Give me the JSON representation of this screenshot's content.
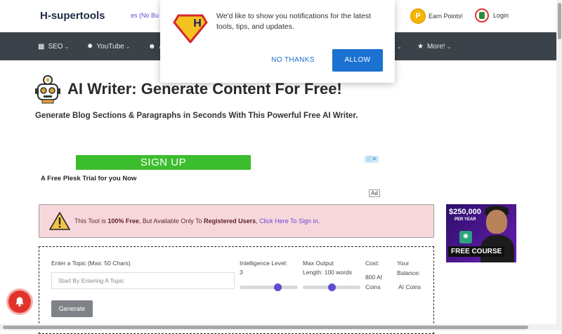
{
  "header": {
    "logo": "H-supertools",
    "ticker": "es (No Bu",
    "earn_points": "Earn Points!",
    "coin_glyph": "P",
    "login": "Login"
  },
  "nav": {
    "items": [
      {
        "label": "SEO",
        "icon": "chart-icon"
      },
      {
        "label": "YouTube",
        "icon": "gear-icon"
      },
      {
        "label": "A",
        "icon": "robot-icon"
      },
      {
        "label": "More!",
        "icon": "star-icon"
      }
    ]
  },
  "page": {
    "title": "AI Writer: Generate Content For Free!",
    "subtitle": "Generate Blog Sections & Paragraphs in Seconds With This Powerful Free AI Writer."
  },
  "ad": {
    "button": "SIGN UP",
    "text": "A Free Plesk Trial for you Now",
    "choice": "ⓘ✕",
    "label": "Ad"
  },
  "alert": {
    "prefix": "This Tool is ",
    "free": "100% Free",
    "middle": ", But Available Only To ",
    "registered": "Registered Users",
    "sep": ", ",
    "link": "Click Here To Sign in",
    "suffix": "."
  },
  "promo": {
    "amount": "$250,000",
    "per": "PER YEAR",
    "course": "FREE COURSE"
  },
  "tool": {
    "topic_label": "Enter a Topic (Max: 50 Chars)",
    "topic_placeholder": "Start By Entering A Topic",
    "intelligence_label": "Intelligence Level:",
    "intelligence_value": "3",
    "intelligence_level": 0.65,
    "output_label": "Max Output",
    "output_value": "Length: 100 words",
    "output_level": 0.5,
    "cost_label": "Cost:",
    "cost_value": "800 AI",
    "cost_unit": "Coins",
    "balance_label": "Your",
    "balance_label2": "Balance:",
    "balance_value": "AI Coins",
    "generate": "Generate"
  },
  "notification": {
    "logo_letter": "H",
    "message": "We'd like to show you notifications for the latest tools, tips, and updates.",
    "no_thanks": "NO THANKS",
    "allow": "ALLOW"
  },
  "colors": {
    "nav_bg": "#3b4249",
    "alert_bg": "#f8d7dc",
    "accent": "#5b4fd0",
    "allow_btn": "#1b72d0",
    "signup_green": "#3cbd2e"
  }
}
